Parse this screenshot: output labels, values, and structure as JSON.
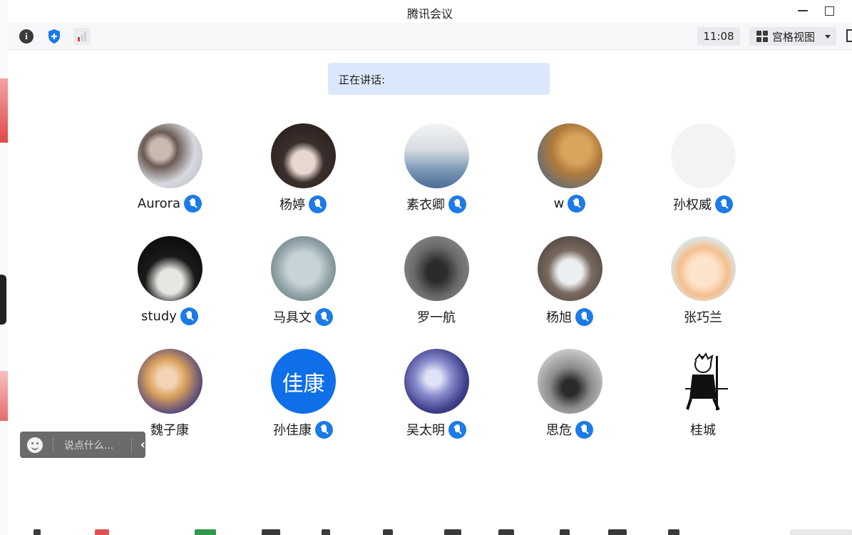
{
  "window": {
    "title": "腾讯会议"
  },
  "toolbar": {
    "time": "11:08",
    "view_label": "宫格视图"
  },
  "speaking": {
    "label": "正在讲话:"
  },
  "participants": [
    {
      "name": "Aurora",
      "muted_icon": true
    },
    {
      "name": "杨婷",
      "muted_icon": true
    },
    {
      "name": "素衣卿",
      "muted_icon": true
    },
    {
      "name": "w",
      "muted_icon": true
    },
    {
      "name": "孙权威",
      "muted_icon": true
    },
    {
      "name": "study",
      "muted_icon": true
    },
    {
      "name": "马具文",
      "muted_icon": true
    },
    {
      "name": "罗一航",
      "muted_icon": false
    },
    {
      "name": "杨旭",
      "muted_icon": true
    },
    {
      "name": "张巧兰",
      "muted_icon": false
    },
    {
      "name": "魏子康",
      "muted_icon": false
    },
    {
      "name": "孙佳康",
      "muted_icon": true,
      "avatar_text": "佳康"
    },
    {
      "name": "吴太明",
      "muted_icon": true
    },
    {
      "name": "思危",
      "muted_icon": true
    },
    {
      "name": "桂城",
      "muted_icon": false
    }
  ],
  "chat": {
    "placeholder": "说点什么..."
  },
  "colors": {
    "accent": "#1c7be6",
    "speaking_bg": "#dbe8fb",
    "chat_bg": "#6b6b6b"
  }
}
